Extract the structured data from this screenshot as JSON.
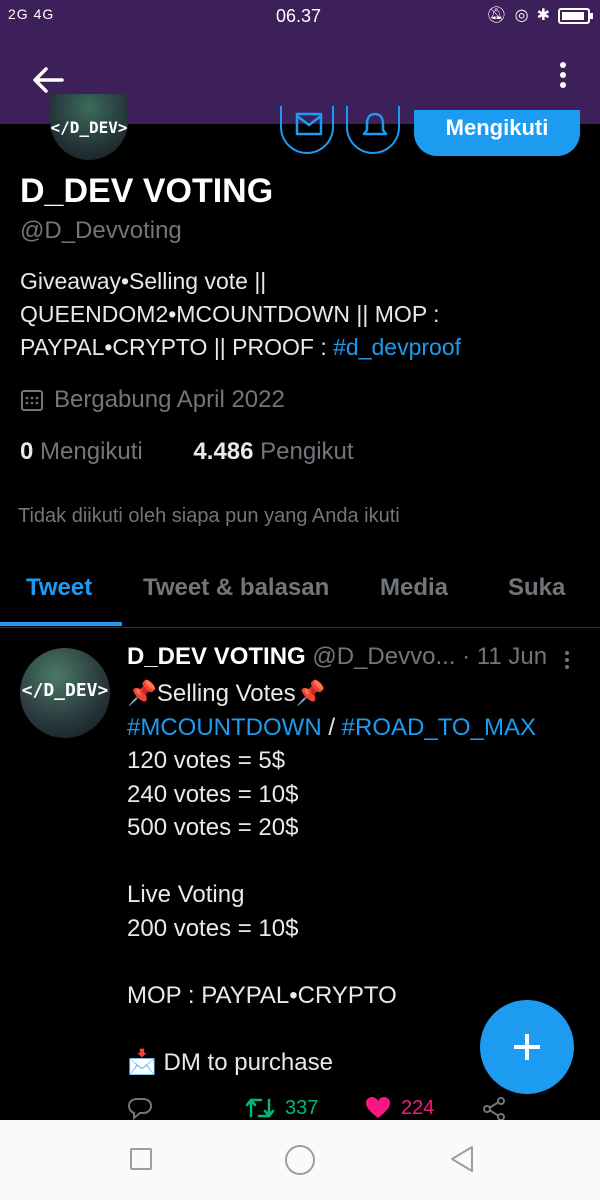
{
  "status_bar": {
    "network": "2G 4G",
    "time": "06.37",
    "icons": [
      "mute-icon",
      "rotation-lock-icon",
      "bluetooth-icon",
      "battery-icon"
    ],
    "colors": {
      "background": "#3d1f5a"
    }
  },
  "app_bar": {
    "back_icon": "arrow-left-icon",
    "overflow_icon": "more-vertical-icon"
  },
  "profile": {
    "avatar_text": "</D_DEV>",
    "follow_button": "Mengikuti",
    "name": "D_DEV VOTING",
    "handle": "@D_Devvoting",
    "bio_line1": "Giveaway•Selling vote ||",
    "bio_line2": "QUEENDOM2•MCOUNTDOWN || MOP :",
    "bio_line3_text": "PAYPAL•CRYPTO ||  PROOF : ",
    "bio_hashtag": "#d_devproof",
    "joined": "Bergabung April 2022",
    "following_count": "0",
    "following_label": "Mengikuti",
    "followers_count": "4.486",
    "followers_label": "Pengikut",
    "not_followed_text": "Tidak diikuti oleh siapa pun yang Anda ikuti"
  },
  "tabs": [
    {
      "label": "Tweet",
      "active": true
    },
    {
      "label": "Tweet & balasan",
      "active": false
    },
    {
      "label": "Media",
      "active": false
    },
    {
      "label": "Suka",
      "active": false
    }
  ],
  "tweet": {
    "avatar_text": "</D_DEV>",
    "name": "D_DEV VOTING",
    "handle": "@D_Devvo...",
    "date": "· 11 Jun",
    "line1": "📌Selling Votes📌",
    "hashtag1": "#MCOUNTDOWN",
    "separator": " / ",
    "hashtag2": "#ROAD_TO_MAX",
    "line3": "120 votes = 5$",
    "line4": "240 votes = 10$",
    "line5": "500 votes = 20$",
    "line6": "Live Voting",
    "line7": "200 votes = 10$",
    "line8": "MOP : PAYPAL•CRYPTO",
    "line9": "📩 DM to purchase",
    "retweets": "337",
    "likes": "224"
  },
  "colors": {
    "accent": "#1d9bf0",
    "retweet": "#00ba7c",
    "like": "#f91880",
    "muted": "#71767b"
  }
}
